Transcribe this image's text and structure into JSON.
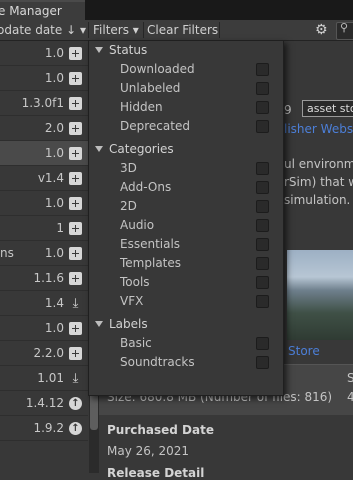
{
  "window": {
    "tab_title": "e Manager"
  },
  "toolbar": {
    "sort_label": "odate date ↓ ▾",
    "filters_label": "Filters ▾",
    "clear_filters_label": "Clear Filters",
    "gear_icon": "gear-icon",
    "search_icon": "search-icon"
  },
  "packages": [
    {
      "name": "",
      "version": "1.0",
      "action": "plus"
    },
    {
      "name": "",
      "version": "1.0",
      "action": "plus"
    },
    {
      "name": "",
      "version": "1.3.0f1",
      "action": "plus"
    },
    {
      "name": "",
      "version": "2.0",
      "action": "plus"
    },
    {
      "name": "",
      "version": "1.0",
      "action": "plus",
      "selected": true
    },
    {
      "name": "",
      "version": "v1.4",
      "action": "plus"
    },
    {
      "name": "",
      "version": "1.0",
      "action": "plus"
    },
    {
      "name": "",
      "version": "1",
      "action": "plus"
    },
    {
      "name": "ns",
      "version": "1.0",
      "action": "plus"
    },
    {
      "name": "",
      "version": "1.1.6",
      "action": "plus"
    },
    {
      "name": "",
      "version": "1.4",
      "action": "download"
    },
    {
      "name": "",
      "version": "1.0",
      "action": "plus"
    },
    {
      "name": "",
      "version": "2.2.0",
      "action": "plus"
    },
    {
      "name": "",
      "version": "1.01",
      "action": "download"
    },
    {
      "name": "",
      "version": "1.4.12",
      "action": "update"
    },
    {
      "name": "",
      "version": "1.9.2",
      "action": "update"
    }
  ],
  "details": {
    "version_fragment": "9",
    "asset_store_button": "asset sto",
    "publisher_link": "lisher Websi",
    "desc_line1": "ul environme",
    "desc_line2": "rSim) that w",
    "desc_line3": "simulation.",
    "store_link": "Store",
    "size_text": "Size: 680.8 MB (Number of files: 816)",
    "size_right": "S",
    "size_right2": "4",
    "purchased_label": "Purchased Date",
    "purchased_value": "May 26, 2021",
    "release_label": "Release Detail"
  },
  "filters_menu": {
    "sections": [
      {
        "title": "Status",
        "items": [
          "Downloaded",
          "Unlabeled",
          "Hidden",
          "Deprecated"
        ]
      },
      {
        "title": "Categories",
        "items": [
          "3D",
          "Add-Ons",
          "2D",
          "Audio",
          "Essentials",
          "Templates",
          "Tools",
          "VFX"
        ]
      },
      {
        "title": "Labels",
        "items": [
          "Basic",
          "Soundtracks"
        ]
      }
    ]
  }
}
